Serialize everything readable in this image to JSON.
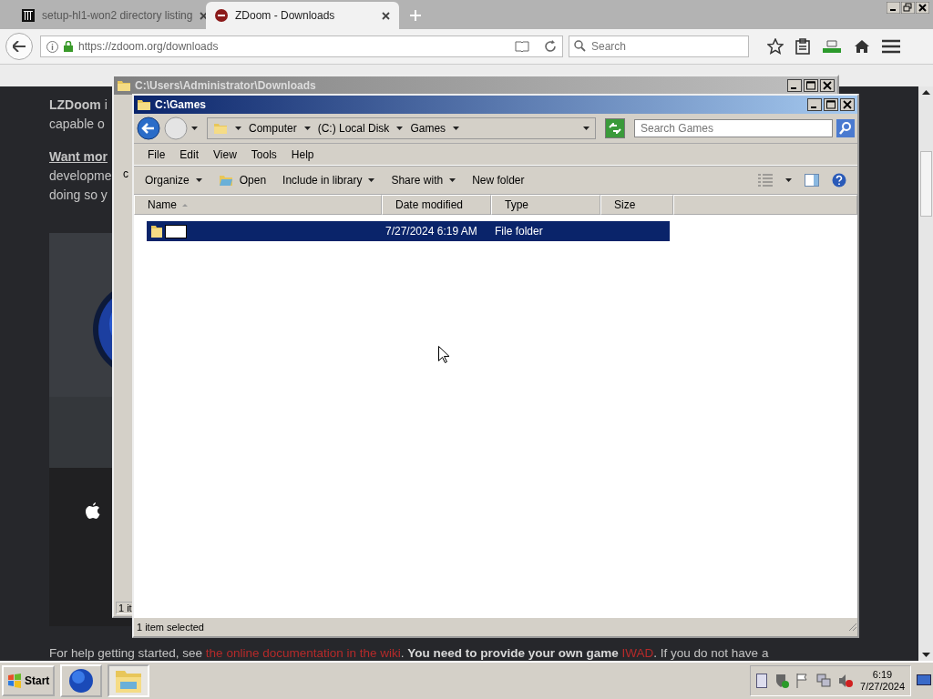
{
  "browser": {
    "tabs": [
      {
        "title": "setup-hl1-won2 directory listing",
        "selected": false
      },
      {
        "title": "ZDoom - Downloads",
        "selected": true
      }
    ],
    "address": "https://zdoom.org/downloads",
    "search": {
      "placeholder": "Search"
    }
  },
  "webpage": {
    "lines": [
      {
        "kind": "plain",
        "text": "**LZDoom** i"
      },
      {
        "kind": "plain",
        "text": "capable o"
      },
      {
        "kind": "link",
        "text": "Want mor"
      },
      {
        "kind": "plain",
        "text": "developme"
      },
      {
        "kind": "plain",
        "text": "doing so y"
      }
    ],
    "help": [
      {
        "kind": "plain",
        "text": "For help getting started, see "
      },
      {
        "kind": "link",
        "text": "the online documentation in the wiki"
      },
      {
        "kind": "plain",
        "text": ". "
      },
      {
        "kind": "bold",
        "text": "You need to provide your own game "
      },
      {
        "kind": "link",
        "text": "IWAD"
      },
      {
        "kind": "plain",
        "text": ". If you do not have a"
      }
    ]
  },
  "back_window": {
    "title": "C:\\Users\\Administrator\\Downloads",
    "fragments": [
      "c"
    ],
    "status": "1 it"
  },
  "window": {
    "title": "C:\\Games",
    "breadcrumb": [
      "Computer",
      "(C:) Local Disk",
      "Games"
    ],
    "search": {
      "placeholder": "Search Games"
    },
    "menu": [
      "File",
      "Edit",
      "View",
      "Tools",
      "Help"
    ],
    "commands": [
      {
        "label": "Organize",
        "kind": "menu"
      },
      {
        "label": "Open",
        "kind": "icon"
      },
      {
        "label": "Include in library",
        "kind": "menu"
      },
      {
        "label": "Share with",
        "kind": "menu"
      },
      {
        "label": "New folder",
        "kind": "plain"
      }
    ],
    "columns": [
      {
        "label": "Name",
        "sorted": true
      },
      {
        "label": "Date modified",
        "sorted": false
      },
      {
        "label": "Type",
        "sorted": false
      },
      {
        "label": "Size",
        "sorted": false
      }
    ],
    "rows": [
      {
        "renaming": true,
        "date": "7/27/2024 6:19 AM",
        "type": "File folder",
        "selected": true
      }
    ],
    "status": "1 item selected"
  },
  "taskbar": {
    "start": "Start",
    "buttons": [
      {
        "kind": "browser",
        "selected": false
      },
      {
        "kind": "explorer",
        "selected": true
      }
    ],
    "time": "6:19",
    "date": "7/27/2024"
  }
}
